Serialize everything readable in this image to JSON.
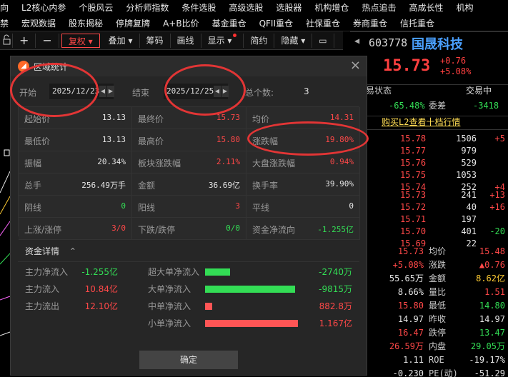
{
  "menu": {
    "row1": [
      "向",
      "L2核心内参",
      "个股风云",
      "分析师指数",
      "条件选股",
      "高级选股",
      "选股器",
      "机构增仓",
      "热点追击",
      "高成长性",
      "机构"
    ],
    "row2": [
      "禁",
      "宏观数据",
      "股东揭秘",
      "停牌复牌",
      "A+B比价",
      "基金重仓",
      "QFII重仓",
      "社保重仓",
      "券商重仓",
      "信托重仓"
    ]
  },
  "toolbar": {
    "items": [
      "复权",
      "叠加",
      "筹码",
      "画线",
      "显示",
      "简约",
      "隐藏"
    ],
    "icons": [
      "lock-icon",
      "plus",
      "minus"
    ]
  },
  "quote": {
    "code": "603778",
    "name": "国晟科技",
    "price": "15.73",
    "chg": "+0.76",
    "pct": "+5.08%",
    "status_label": "易状态",
    "status_right": "交易中",
    "wei_label": "委差",
    "wei_pct": "-65.48%",
    "wei_val": "-3418",
    "l2_link": "购买L2查看十档行情",
    "sell": [
      {
        "p": "15.78",
        "v": "1506",
        "d": "+5"
      },
      {
        "p": "15.77",
        "v": "979",
        "d": ""
      },
      {
        "p": "15.76",
        "v": "529",
        "d": ""
      },
      {
        "p": "15.75",
        "v": "1053",
        "d": ""
      },
      {
        "p": "15.74",
        "v": "252",
        "d": "+4"
      }
    ],
    "buy": [
      {
        "p": "15.73",
        "v": "241",
        "d": "+13"
      },
      {
        "p": "15.72",
        "v": "40",
        "d": "+16"
      },
      {
        "p": "15.71",
        "v": "197",
        "d": ""
      },
      {
        "p": "15.70",
        "v": "401",
        "d": "-20"
      },
      {
        "p": "15.69",
        "v": "22",
        "d": ""
      }
    ],
    "stats": [
      {
        "a": "15.73",
        "al": "均价",
        "b": "15.48",
        "ac": "red",
        "bc": "red"
      },
      {
        "a": "+5.08%",
        "al": "涨跌",
        "b": "▲0.76",
        "ac": "red",
        "bc": "red"
      },
      {
        "a": "55.65万",
        "al": "金额",
        "b": "8.62亿",
        "ac": "white",
        "bc": "yellow"
      },
      {
        "a": "8.66%",
        "al": "量比",
        "b": "1.51",
        "ac": "white",
        "bc": "red"
      },
      {
        "a": "15.80",
        "al": "最低",
        "b": "14.80",
        "ac": "red",
        "bc": "green"
      },
      {
        "a": "14.97",
        "al": "昨收",
        "b": "14.97",
        "ac": "white",
        "bc": "white"
      },
      {
        "a": "16.47",
        "al": "跌停",
        "b": "13.47",
        "ac": "red",
        "bc": "green"
      },
      {
        "a": "26.59万",
        "al": "内盘",
        "b": "29.05万",
        "ac": "red",
        "bc": "green"
      },
      {
        "a": "1.11",
        "al": "ROE",
        "b": "-19.17%",
        "ac": "white",
        "bc": "white"
      },
      {
        "a": "-0.230",
        "al": "PE(动)",
        "b": "-51.29",
        "ac": "white",
        "bc": "white"
      }
    ]
  },
  "dialog": {
    "title": "区域统计",
    "start_label": "开始",
    "start_date": "2025/12/23",
    "end_label": "结束",
    "end_date": "2025/12/25",
    "total_label": "总个数:",
    "total": "3",
    "stats": [
      [
        {
          "k": "起始价",
          "v": "13.13",
          "c": "white"
        },
        {
          "k": "最终价",
          "v": "15.73",
          "c": "red"
        },
        {
          "k": "均价",
          "v": "14.31",
          "c": "red"
        }
      ],
      [
        {
          "k": "最低价",
          "v": "13.13",
          "c": "white"
        },
        {
          "k": "最高价",
          "v": "15.80",
          "c": "red"
        },
        {
          "k": "涨跌幅",
          "v": "19.80%",
          "c": "red"
        }
      ],
      [
        {
          "k": "振幅",
          "v": "20.34%",
          "c": "white"
        },
        {
          "k": "板块涨跌幅",
          "v": "2.11%",
          "c": "red"
        },
        {
          "k": "大盘涨跌幅",
          "v": "0.94%",
          "c": "red"
        }
      ],
      [
        {
          "k": "总手",
          "v": "256.49万手",
          "c": "white"
        },
        {
          "k": "金额",
          "v": "36.69亿",
          "c": "white"
        },
        {
          "k": "换手率",
          "v": "39.90%",
          "c": "white"
        }
      ],
      [
        {
          "k": "阴线",
          "v": "0",
          "c": "green"
        },
        {
          "k": "阳线",
          "v": "3",
          "c": "red"
        },
        {
          "k": "平线",
          "v": "0",
          "c": "white"
        }
      ],
      [
        {
          "k": "上涨/涨停",
          "v": "3/0",
          "c": "red"
        },
        {
          "k": "下跌/跌停",
          "v": "0/0",
          "c": "green"
        },
        {
          "k": "资金净流向",
          "v": "-1.255亿",
          "c": "green"
        }
      ]
    ],
    "funds_title": "资金详情",
    "funds_left": [
      {
        "k": "主力净流入",
        "v": "-1.255亿",
        "c": "green"
      },
      {
        "k": "主力流入",
        "v": "10.84亿",
        "c": "red"
      },
      {
        "k": "主力流出",
        "v": "12.10亿",
        "c": "red"
      }
    ],
    "funds_right": [
      {
        "k": "超大单净流入",
        "v": "-2740万",
        "c": "green",
        "fill": 0.27,
        "bc": "#33dd55"
      },
      {
        "k": "大单净流入",
        "v": "-9815万",
        "c": "green",
        "fill": 0.97,
        "bc": "#33dd55"
      },
      {
        "k": "中单净流入",
        "v": "882.8万",
        "c": "red",
        "fill": 0.08,
        "bc": "#ff5555"
      },
      {
        "k": "小单净流入",
        "v": "1.167亿",
        "c": "red",
        "fill": 1.0,
        "bc": "#ff5555"
      }
    ],
    "ok": "确定"
  }
}
